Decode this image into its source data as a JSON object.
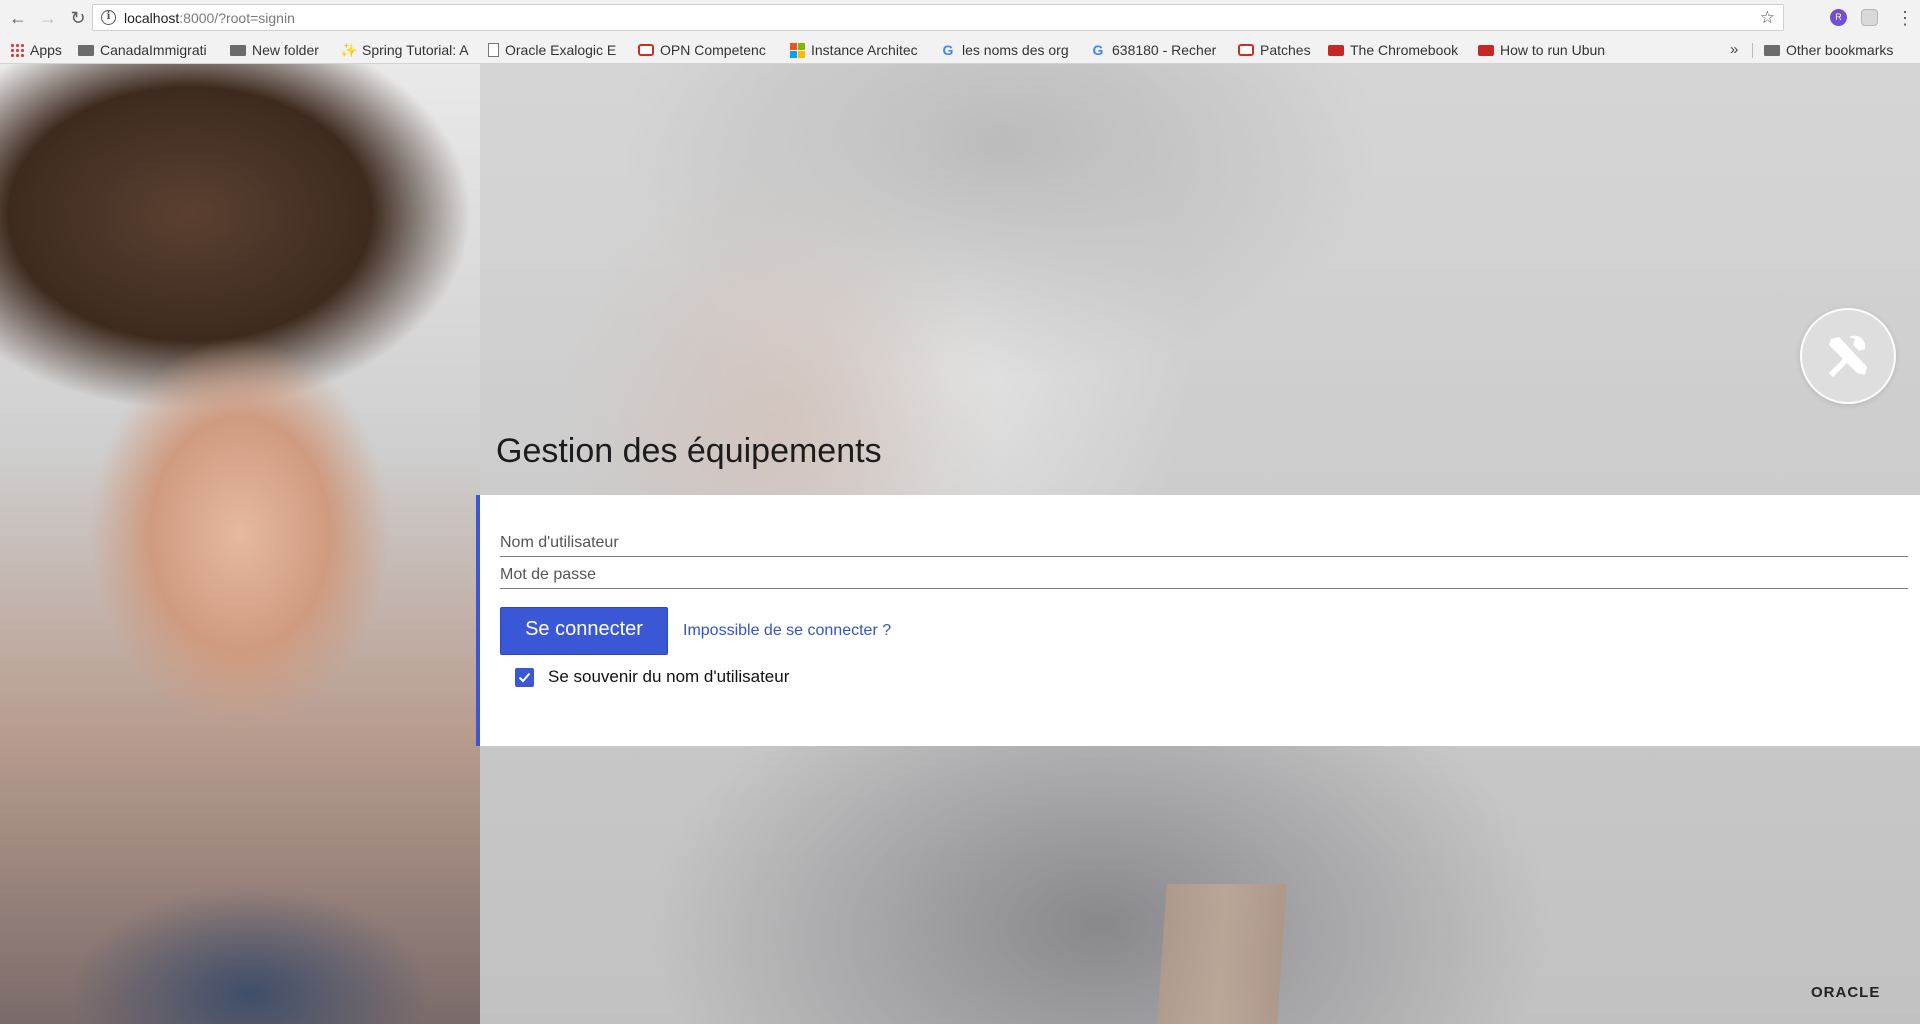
{
  "browser": {
    "url_host": "localhost",
    "url_path": ":8000/?root=signin",
    "extension_icons": [
      "extension-purple-icon",
      "extension-gray-icon"
    ],
    "bookmarks": [
      {
        "label": "Apps",
        "icon": "apps-grid-icon"
      },
      {
        "label": "CanadaImmigrati",
        "icon": "folder-icon"
      },
      {
        "label": "New folder",
        "icon": "folder-icon"
      },
      {
        "label": "Spring Tutorial: A",
        "icon": "spring-icon"
      },
      {
        "label": "Oracle Exalogic E",
        "icon": "document-icon"
      },
      {
        "label": "OPN Competenc",
        "icon": "oracle-icon"
      },
      {
        "label": "Instance Architec",
        "icon": "microsoft-icon"
      },
      {
        "label": "les noms des org",
        "icon": "google-icon"
      },
      {
        "label": "638180 - Recher",
        "icon": "google-icon"
      },
      {
        "label": "Patches",
        "icon": "oracle-icon"
      },
      {
        "label": "The Chromebook",
        "icon": "red-laptop-icon"
      },
      {
        "label": "How to run Ubun",
        "icon": "red-laptop-icon"
      }
    ],
    "overflow_label": "»",
    "other_bookmarks": "Other bookmarks"
  },
  "app": {
    "title": "Gestion des équipements",
    "badge_icon": "tools-icon",
    "brand": "ORACLE"
  },
  "login": {
    "username_placeholder": "Nom d'utilisateur",
    "username_value": "",
    "password_placeholder": "Mot de passe",
    "password_value": "",
    "signin_label": "Se connecter",
    "help_link": "Impossible de se connecter ?",
    "remember_label": "Se souvenir du nom d'utilisateur",
    "remember_checked": true
  },
  "colors": {
    "accent": "#3a57d6",
    "link": "#2f56c6"
  }
}
